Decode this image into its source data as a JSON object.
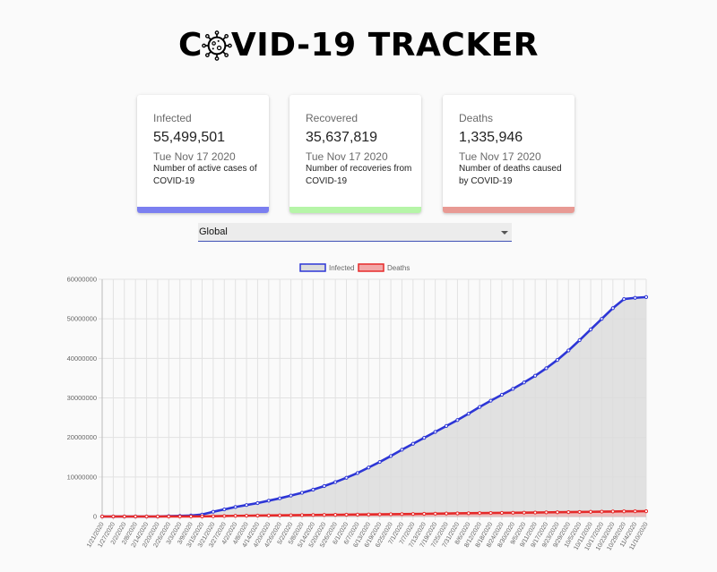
{
  "title": {
    "before": "C",
    "after": "VID-19 TRACKER",
    "logo_icon": "coronavirus-icon"
  },
  "cards": [
    {
      "label": "Infected",
      "value": "55,499,501",
      "date": "Tue Nov 17 2020",
      "desc": "Number of active cases of COVID-19",
      "color": "#7b7ff0"
    },
    {
      "label": "Recovered",
      "value": "35,637,819",
      "date": "Tue Nov 17 2020",
      "desc": "Number of recoveries from COVID-19",
      "color": "#b6f5a8"
    },
    {
      "label": "Deaths",
      "value": "1,335,946",
      "date": "Tue Nov 17 2020",
      "desc": "Number of deaths caused by COVID-19",
      "color": "#e89a94"
    }
  ],
  "country_select": {
    "value": "Global"
  },
  "chart_data": {
    "type": "line",
    "legend": [
      "Infected",
      "Deaths"
    ],
    "legend_position": "top",
    "grid": true,
    "ylim": [
      0,
      60000000
    ],
    "yticks": [
      "0",
      "10000000",
      "20000000",
      "30000000",
      "40000000",
      "50000000",
      "60000000"
    ],
    "x_ticks": [
      "1/21/2020",
      "1/27/2020",
      "2/2/2020",
      "2/8/2020",
      "2/14/2020",
      "2/20/2020",
      "2/26/2020",
      "3/3/2020",
      "3/9/2020",
      "3/15/2020",
      "3/21/2020",
      "3/27/2020",
      "4/2/2020",
      "4/8/2020",
      "4/14/2020",
      "4/20/2020",
      "4/26/2020",
      "5/2/2020",
      "5/8/2020",
      "5/14/2020",
      "5/20/2020",
      "5/26/2020",
      "6/1/2020",
      "6/7/2020",
      "6/13/2020",
      "6/19/2020",
      "6/25/2020",
      "7/1/2020",
      "7/7/2020",
      "7/13/2020",
      "7/19/2020",
      "7/25/2020",
      "7/31/2020",
      "8/6/2020",
      "8/12/2020",
      "8/18/2020",
      "8/24/2020",
      "8/30/2020",
      "9/5/2020",
      "9/11/2020",
      "9/17/2020",
      "9/23/2020",
      "9/29/2020",
      "10/5/2020",
      "10/11/2020",
      "10/17/2020",
      "10/23/2020",
      "10/29/2020",
      "11/4/2020",
      "11/10/2020"
    ],
    "series": [
      {
        "name": "Infected",
        "color": "#2d36d6",
        "fill": "#dcdcdc",
        "values": [
          0,
          0,
          0,
          0,
          0,
          0,
          100000,
          150000,
          250000,
          500000,
          1200000,
          1800000,
          2400000,
          2900000,
          3400000,
          4000000,
          4600000,
          5300000,
          6000000,
          6800000,
          7700000,
          8700000,
          9800000,
          11000000,
          12400000,
          13800000,
          15300000,
          16900000,
          18400000,
          19900000,
          21400000,
          22900000,
          24400000,
          26000000,
          27700000,
          29300000,
          30800000,
          32300000,
          33900000,
          35600000,
          37500000,
          39600000,
          42000000,
          44600000,
          47300000,
          50000000,
          52700000,
          55000000,
          55300000,
          55499501
        ]
      },
      {
        "name": "Deaths",
        "color": "#e62a2a",
        "fill": "#f2a8a8",
        "values": [
          0,
          0,
          0,
          0,
          0,
          0,
          4000,
          6000,
          12000,
          30000,
          70000,
          130000,
          170000,
          200000,
          230000,
          260000,
          290000,
          320000,
          350000,
          380000,
          400000,
          430000,
          460000,
          490000,
          520000,
          550000,
          580000,
          610000,
          640000,
          680000,
          720000,
          760000,
          800000,
          830000,
          860000,
          890000,
          920000,
          950000,
          980000,
          1010000,
          1050000,
          1080000,
          1110000,
          1150000,
          1190000,
          1230000,
          1270000,
          1310000,
          1320000,
          1335946
        ]
      }
    ]
  }
}
